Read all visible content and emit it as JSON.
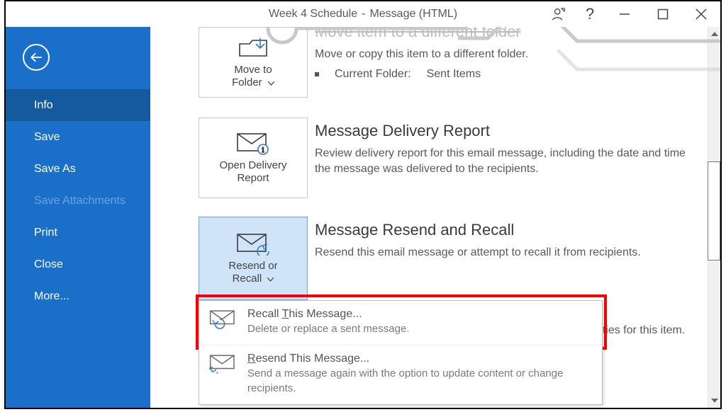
{
  "title": {
    "doc": "Week 4 Schedule",
    "sep": "-",
    "kind": "Message (HTML)"
  },
  "win": {
    "help": "?"
  },
  "sidebar": {
    "items": [
      {
        "label": "Info",
        "active": true,
        "disabled": false
      },
      {
        "label": "Save",
        "active": false,
        "disabled": false
      },
      {
        "label": "Save As",
        "active": false,
        "disabled": false
      },
      {
        "label": "Save Attachments",
        "active": false,
        "disabled": true
      },
      {
        "label": "Print",
        "active": false,
        "disabled": false
      },
      {
        "label": "Close",
        "active": false,
        "disabled": false
      },
      {
        "label": "More...",
        "active": false,
        "disabled": false
      }
    ]
  },
  "tiles": {
    "move": {
      "line1": "Move to",
      "line2": "Folder"
    },
    "report": {
      "line1": "Open Delivery",
      "line2": "Report"
    },
    "resend": {
      "line1": "Resend or",
      "line2": "Recall"
    }
  },
  "sec_move": {
    "head": "Move item to a different folder",
    "body": "Move or copy this item to a different folder.",
    "bullet_label": "Current Folder:",
    "bullet_value": "Sent Items"
  },
  "sec_report": {
    "head": "Message Delivery Report",
    "body": "Review delivery report for this email message, including the date and time the message was delivered to the recipients."
  },
  "sec_recall": {
    "head": "Message Resend and Recall",
    "body": "Resend this email message or attempt to recall it from recipients."
  },
  "sec_props": {
    "tail": "s and properties for this item."
  },
  "menu": {
    "recall": {
      "title_pre": "Recall ",
      "title_u": "T",
      "title_post": "his Message...",
      "desc": "Delete or replace a sent message."
    },
    "resend": {
      "title_pre": "",
      "title_u": "R",
      "title_post": "esend This Message...",
      "desc": "Send a message again with the option to update content or change recipients."
    }
  }
}
